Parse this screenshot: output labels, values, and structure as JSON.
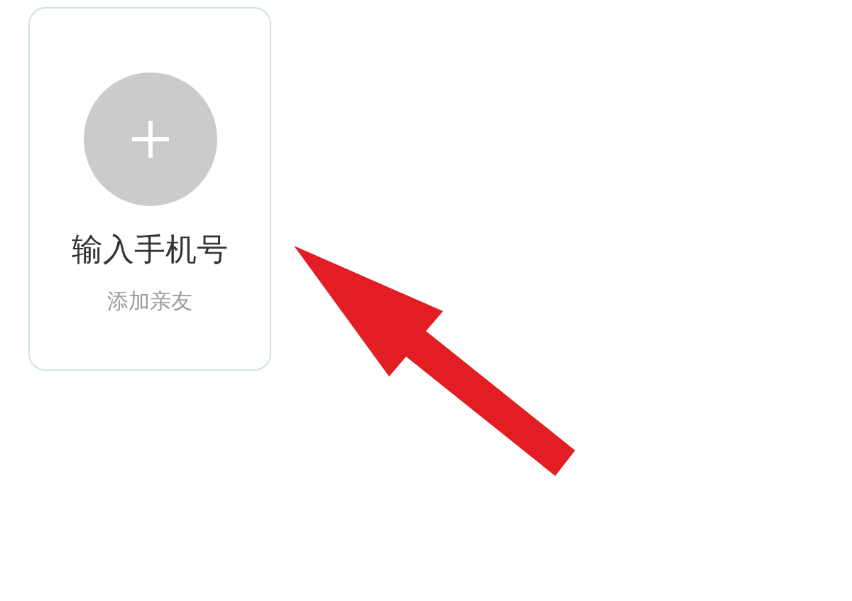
{
  "contact_card": {
    "title": "输入手机号",
    "subtitle": "添加亲友"
  }
}
